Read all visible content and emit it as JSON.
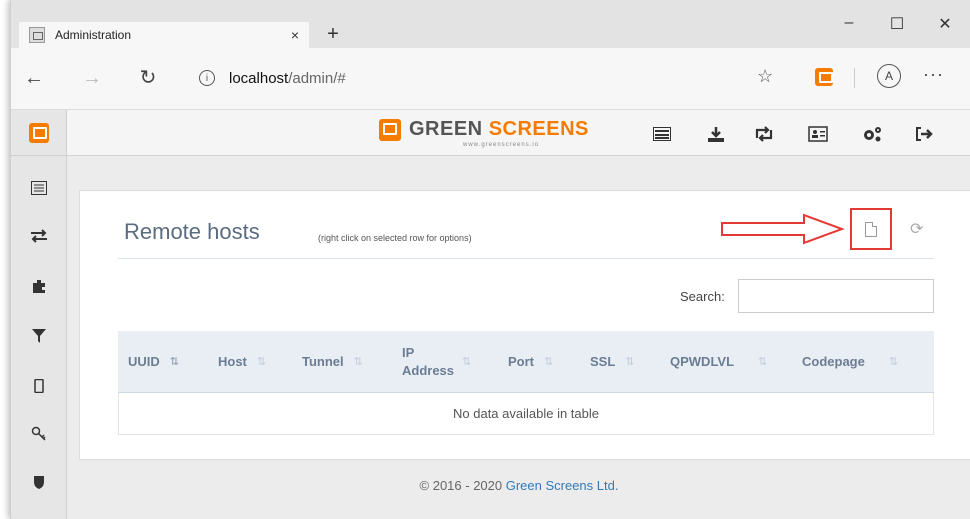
{
  "browser": {
    "tab_title": "Administration",
    "tab_close": "×",
    "new_tab": "+",
    "minimize": "–",
    "maximize": "☐",
    "close": "✕",
    "url_host": "localhost",
    "url_path": "/admin/#",
    "profile_initial": "A",
    "more": "···"
  },
  "brand": {
    "green": "GREEN",
    "screens": "SCREENS",
    "sub": "www.greenscreens.io",
    "accent_color": "#f57c00"
  },
  "page": {
    "title": "Remote hosts",
    "hint": "(right click on selected row for options)"
  },
  "search": {
    "label": "Search:",
    "value": ""
  },
  "table": {
    "columns": [
      {
        "label": "UUID",
        "sort": "asc"
      },
      {
        "label": "Host",
        "sort": "none"
      },
      {
        "label": "Tunnel",
        "sort": "none"
      },
      {
        "label": "IP Address",
        "sort": "none"
      },
      {
        "label": "Port",
        "sort": "none"
      },
      {
        "label": "SSL",
        "sort": "none"
      },
      {
        "label": "QPWDLVL",
        "sort": "none"
      },
      {
        "label": "Codepage",
        "sort": "none"
      }
    ],
    "empty_message": "No data available in table"
  },
  "footer": {
    "copyright": "© 2016 - 2020 ",
    "company": "Green Screens Ltd."
  }
}
